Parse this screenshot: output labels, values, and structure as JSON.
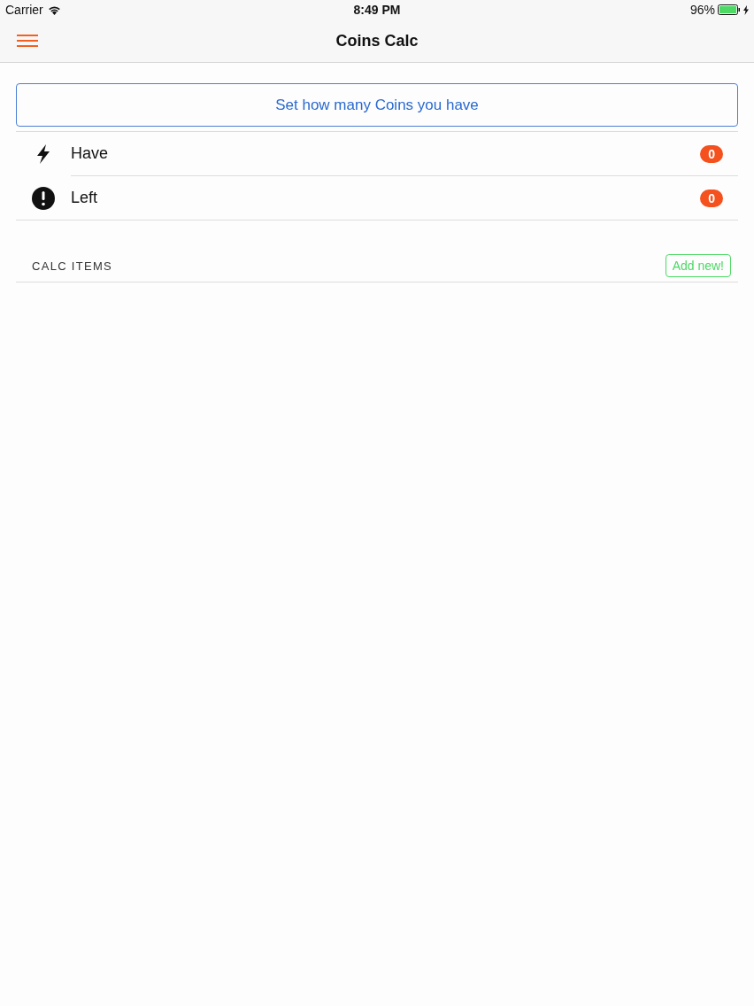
{
  "status_bar": {
    "carrier": "Carrier",
    "time": "8:49 PM",
    "battery": "96%"
  },
  "nav_bar": {
    "title": "Coins Calc"
  },
  "set_button": {
    "label": "Set how many Coins you have"
  },
  "stats": [
    {
      "kind": "bolt",
      "label": "Have",
      "count": "0"
    },
    {
      "kind": "alert",
      "label": "Left",
      "count": "0"
    }
  ],
  "section": {
    "title": "CALC ITEMS",
    "action": "Add new!"
  }
}
